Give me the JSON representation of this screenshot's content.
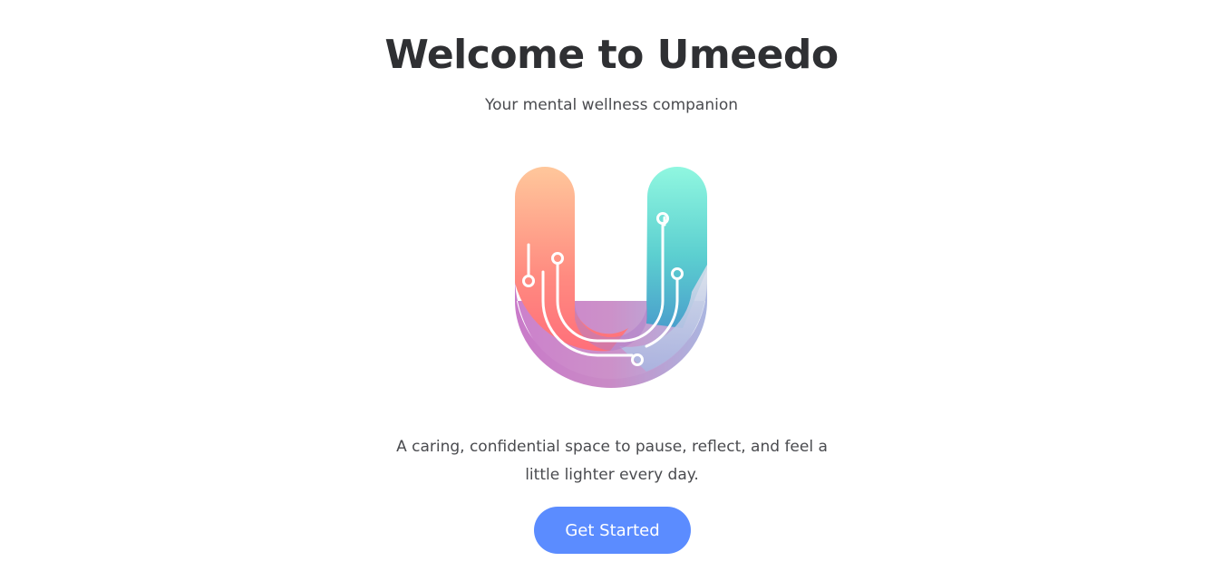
{
  "header": {
    "title": "Welcome to Umeedo",
    "subtitle": "Your mental wellness companion"
  },
  "logo": {
    "icon": "umeedo-u-circuit-logo",
    "colors": {
      "left_arm_top": "#ffc49a",
      "left_arm_bottom": "#ff7a7e",
      "right_arm_top": "#8ff5df",
      "right_arm_bottom": "#4aa8c8",
      "base_purple": "#c77bc8",
      "base_lavender": "#b8c6e8"
    }
  },
  "main": {
    "tagline": "A caring, confidential space to pause, reflect, and feel a little lighter every day.",
    "cta_label": "Get Started"
  },
  "theme": {
    "accent": "#5b8cff",
    "text": "#2f3033"
  }
}
